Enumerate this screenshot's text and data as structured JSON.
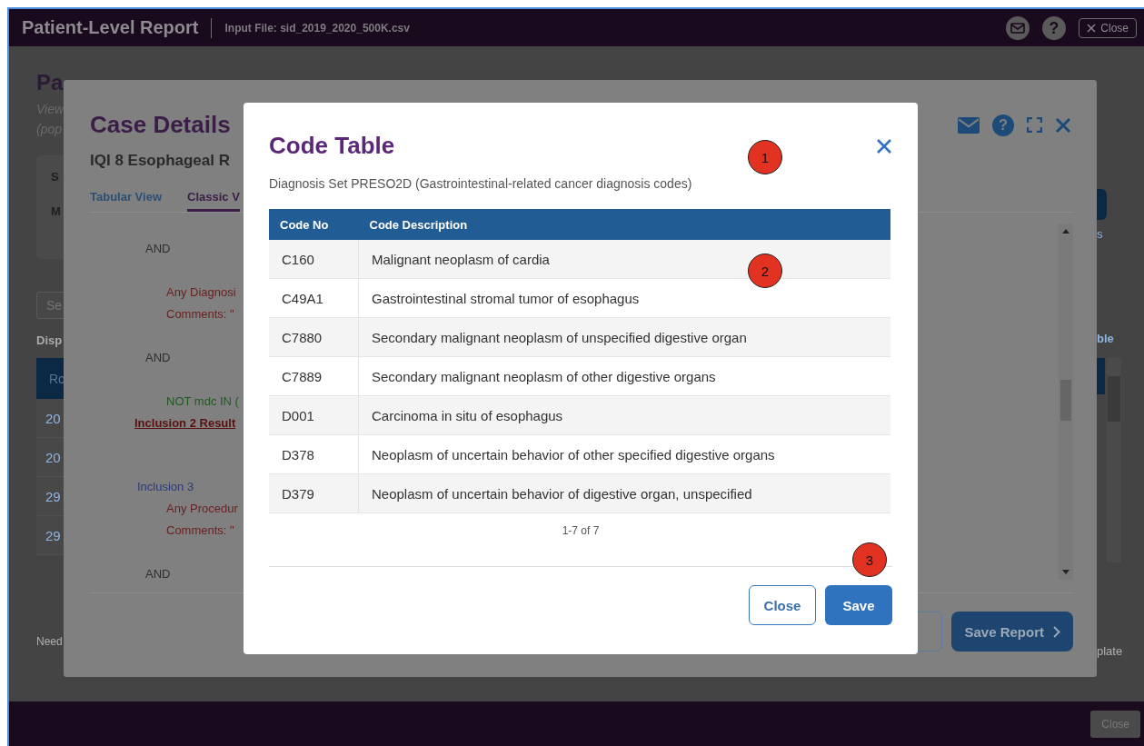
{
  "app_bar": {
    "title": "Patient-Level Report",
    "input_file": "Input File: sid_2019_2020_500K.csv",
    "close_label": "Close",
    "help_icon": "?"
  },
  "page": {
    "title": "Pa",
    "description_lines": [
      "View",
      "(pop"
    ],
    "card_labels": [
      "S",
      "M"
    ],
    "search_placeholder": "Se",
    "section_heading": "Disp",
    "table_header": "Ro",
    "table_cells": [
      "20",
      "20",
      "29",
      "29"
    ],
    "right_link": "s",
    "right_heading": "ble",
    "footer_left": "Need",
    "footer_right": "plate"
  },
  "footer_bar": {
    "close_label": "Close"
  },
  "case_details": {
    "title": "Case Details",
    "subtitle": "IQI 8 Esophageal R",
    "tabs": [
      {
        "label": "Tabular View",
        "selected": false
      },
      {
        "label": "Classic V",
        "selected": true
      }
    ],
    "logic_lines": [
      {
        "kind": "operator",
        "text": "AND"
      },
      {
        "kind": "condition",
        "text": "Any Diagnosi"
      },
      {
        "kind": "comment",
        "text": "Comments: \""
      },
      {
        "kind": "operator",
        "text": "AND"
      },
      {
        "kind": "exclusion",
        "text": "NOT mdc IN ("
      },
      {
        "kind": "result",
        "text": "Inclusion 2 Result"
      },
      {
        "kind": "group",
        "text": "Inclusion 3"
      },
      {
        "kind": "condition",
        "text": "Any Procedur"
      },
      {
        "kind": "comment",
        "text": "Comments: \""
      },
      {
        "kind": "operator",
        "text": "AND"
      }
    ],
    "save_label": "Save Report",
    "help_icon": "?"
  },
  "code_table": {
    "title": "Code Table",
    "subtitle": "Diagnosis Set PRESO2D (Gastrointestinal-related cancer diagnosis codes)",
    "columns": [
      "Code No",
      "Code Description"
    ],
    "rows": [
      {
        "code": "C160",
        "description": "Malignant neoplasm of cardia"
      },
      {
        "code": "C49A1",
        "description": "Gastrointestinal stromal tumor of esophagus"
      },
      {
        "code": "C7880",
        "description": "Secondary malignant neoplasm of unspecified digestive organ"
      },
      {
        "code": "C7889",
        "description": "Secondary malignant neoplasm of other digestive organs"
      },
      {
        "code": "D001",
        "description": "Carcinoma in situ of esophagus"
      },
      {
        "code": "D378",
        "description": "Neoplasm of uncertain behavior of other specified digestive organs"
      },
      {
        "code": "D379",
        "description": "Neoplasm of uncertain behavior of digestive organ, unspecified"
      }
    ],
    "pagination": "1-7 of 7",
    "close_label": "Close",
    "save_label": "Save"
  },
  "callouts": [
    "1",
    "2",
    "3"
  ]
}
